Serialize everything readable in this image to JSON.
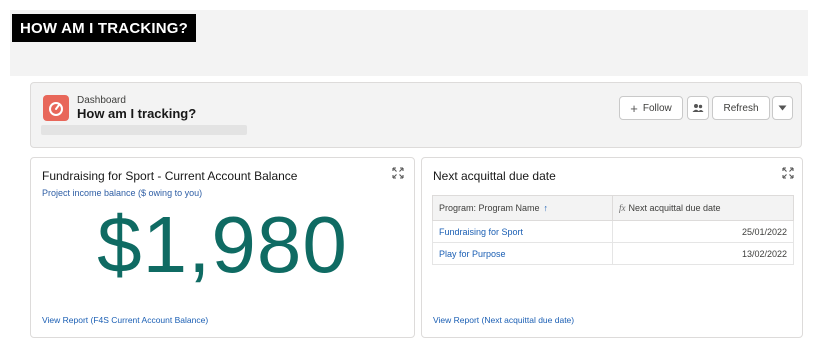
{
  "banner": {
    "title": "HOW AM I TRACKING?"
  },
  "dashboard": {
    "type_label": "Dashboard",
    "title": "How am I tracking?",
    "follow_label": "Follow",
    "refresh_label": "Refresh",
    "icon_color": "#e8675a"
  },
  "balance_card": {
    "title": "Fundraising for Sport - Current Account Balance",
    "subtitle": "Project income balance ($ owing to you)",
    "value": "$1,980",
    "value_color": "#0f6b63",
    "report_link": "View Report (F4S Current Account Balance)"
  },
  "due_card": {
    "title": "Next acquittal due date",
    "columns": [
      "Program: Program Name",
      "Next acquittal due date"
    ],
    "sort_indicator": "↑",
    "formula_label": "fx",
    "rows": [
      {
        "program": "Fundraising for Sport",
        "date": "25/01/2022"
      },
      {
        "program": "Play for Purpose",
        "date": "13/02/2022"
      }
    ],
    "report_link": "View Report (Next acquittal due date)"
  }
}
